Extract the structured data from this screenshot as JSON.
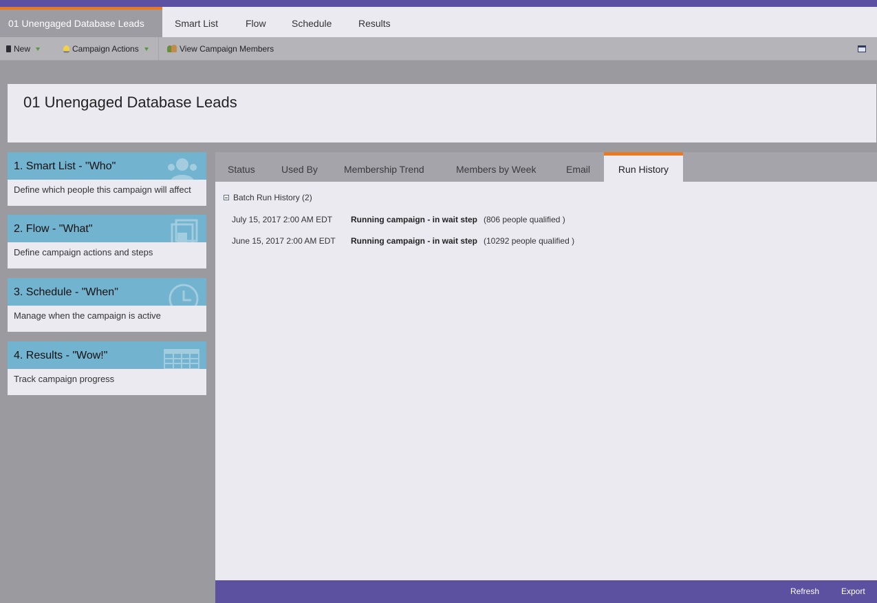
{
  "main_tabs": {
    "active": "01 Unengaged Database Leads",
    "smart_list": "Smart List",
    "flow": "Flow",
    "schedule": "Schedule",
    "results": "Results"
  },
  "toolbar": {
    "new_label": "New",
    "campaign_actions_label": "Campaign Actions",
    "view_members_label": "View Campaign Members"
  },
  "page_title": "01 Unengaged Database Leads",
  "steps": [
    {
      "title": "1. Smart List - \"Who\"",
      "desc": "Define which people this campaign will affect",
      "icon": "people-icon"
    },
    {
      "title": "2. Flow - \"What\"",
      "desc": "Define campaign actions and steps",
      "icon": "layers-icon"
    },
    {
      "title": "3. Schedule - \"When\"",
      "desc": "Manage when the campaign is active",
      "icon": "clock-icon"
    },
    {
      "title": "4. Results - \"Wow!\"",
      "desc": "Track campaign progress",
      "icon": "table-icon"
    }
  ],
  "sub_tabs": {
    "status": "Status",
    "used_by": "Used By",
    "membership_trend": "Membership Trend",
    "members_by_week": "Members by Week",
    "email": "Email",
    "run_history": "Run History"
  },
  "run_history": {
    "header": "Batch Run History (2)",
    "rows": [
      {
        "date": "July 15, 2017 2:00 AM EDT",
        "status": "Running campaign - in wait step",
        "count": "(806 people qualified )"
      },
      {
        "date": "June 15, 2017 2:00 AM EDT",
        "status": "Running campaign - in wait step",
        "count": "(10292 people qualified )"
      }
    ]
  },
  "footer": {
    "refresh": "Refresh",
    "export": "Export"
  },
  "colors": {
    "brand_purple": "#5b51a0",
    "accent_orange": "#e87a25",
    "step_blue": "#72b3cf"
  }
}
